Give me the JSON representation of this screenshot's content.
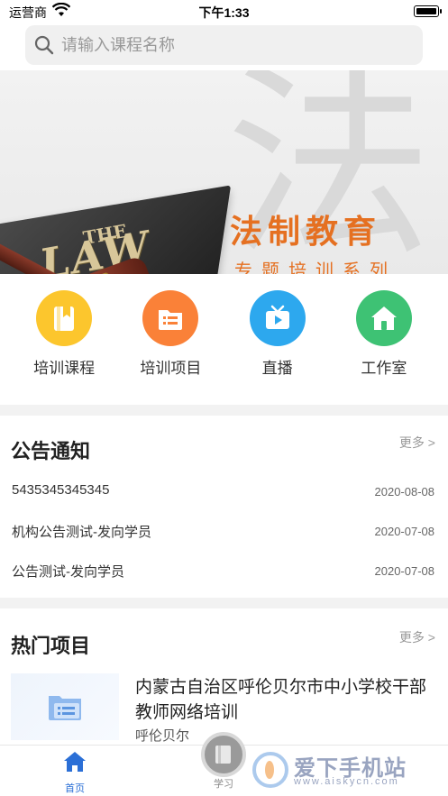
{
  "status_bar": {
    "carrier": "运营商",
    "time": "下午1:33"
  },
  "search": {
    "placeholder": "请输入课程名称"
  },
  "banner": {
    "book_small": "THE",
    "book_big": "LAW",
    "title": "法制教育",
    "subtitle": "专题培训系列",
    "bg_glyph": "法"
  },
  "nav": [
    {
      "label": "培训课程",
      "icon": "book-icon",
      "color": "#FCC62D"
    },
    {
      "label": "培训项目",
      "icon": "list-icon",
      "color": "#FA8138"
    },
    {
      "label": "直播",
      "icon": "tv-icon",
      "color": "#2DA8EE"
    },
    {
      "label": "工作室",
      "icon": "home-icon",
      "color": "#3EC274"
    }
  ],
  "notice": {
    "title": "公告通知",
    "more": "更多 >",
    "items": [
      {
        "title": "5435345345345",
        "date": "2020-08-08"
      },
      {
        "title": "机构公告测试-发向学员",
        "date": "2020-07-08"
      },
      {
        "title": "公告测试-发向学员",
        "date": "2020-07-08"
      }
    ]
  },
  "hot": {
    "title": "热门项目",
    "more": "更多 >",
    "project": {
      "title": "内蒙古自治区呼伦贝尔市中小学校干部教师网络培训",
      "sub": "呼伦贝尔"
    }
  },
  "tabbar": {
    "home": "首页",
    "study": "学习"
  },
  "watermark": {
    "cn": "爱下手机站",
    "url": "www.aiskycn.com"
  },
  "colors": {
    "accent": "#2B6FD6",
    "banner_text": "#E57021"
  }
}
